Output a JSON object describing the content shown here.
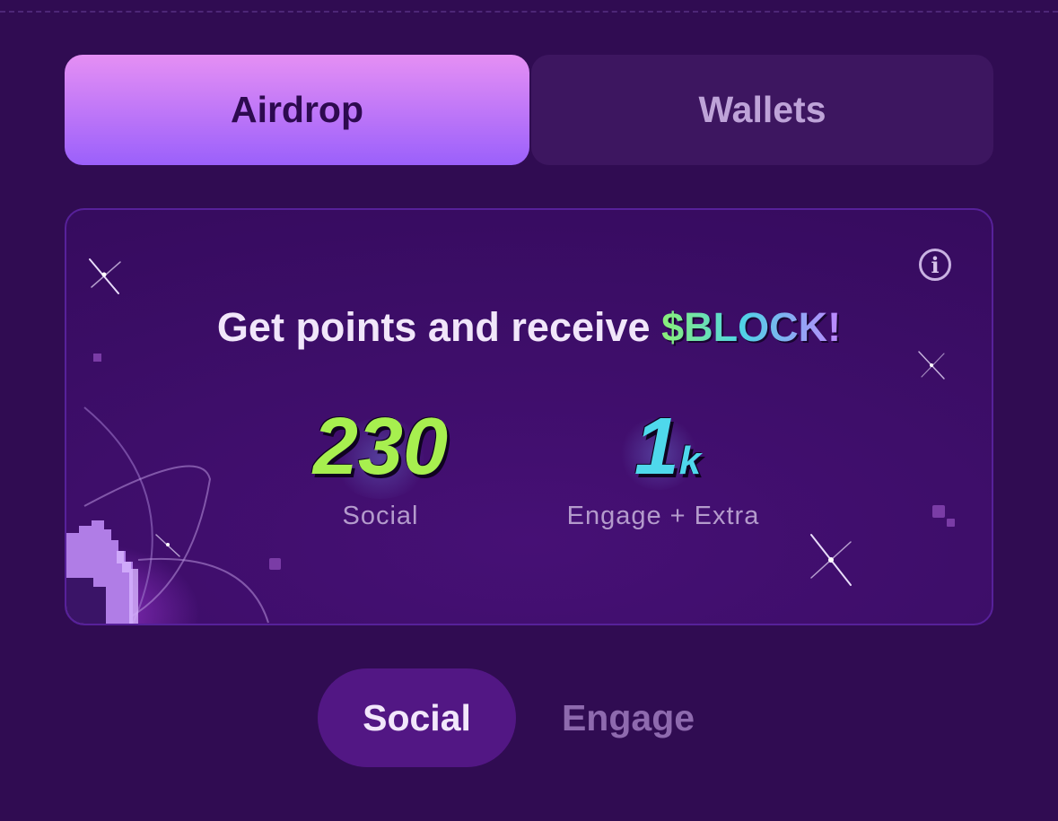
{
  "tabs": {
    "airdrop": "Airdrop",
    "wallets": "Wallets"
  },
  "card": {
    "headline": "Get points and receive ",
    "token": "$BLOCK!",
    "info_icon": "info-icon",
    "stats": {
      "social_value": "230",
      "social_label": "Social",
      "engage_value": "1",
      "engage_unit": "k",
      "engage_label": "Engage + Extra"
    }
  },
  "subtabs": {
    "social": "Social",
    "engage": "Engage"
  },
  "colors": {
    "background": "#300c52",
    "accent_gradient_start": "#e58ff4",
    "accent_gradient_end": "#9b60fb",
    "social_value": "#a7ef4f",
    "engage_value": "#4fd8ec"
  }
}
